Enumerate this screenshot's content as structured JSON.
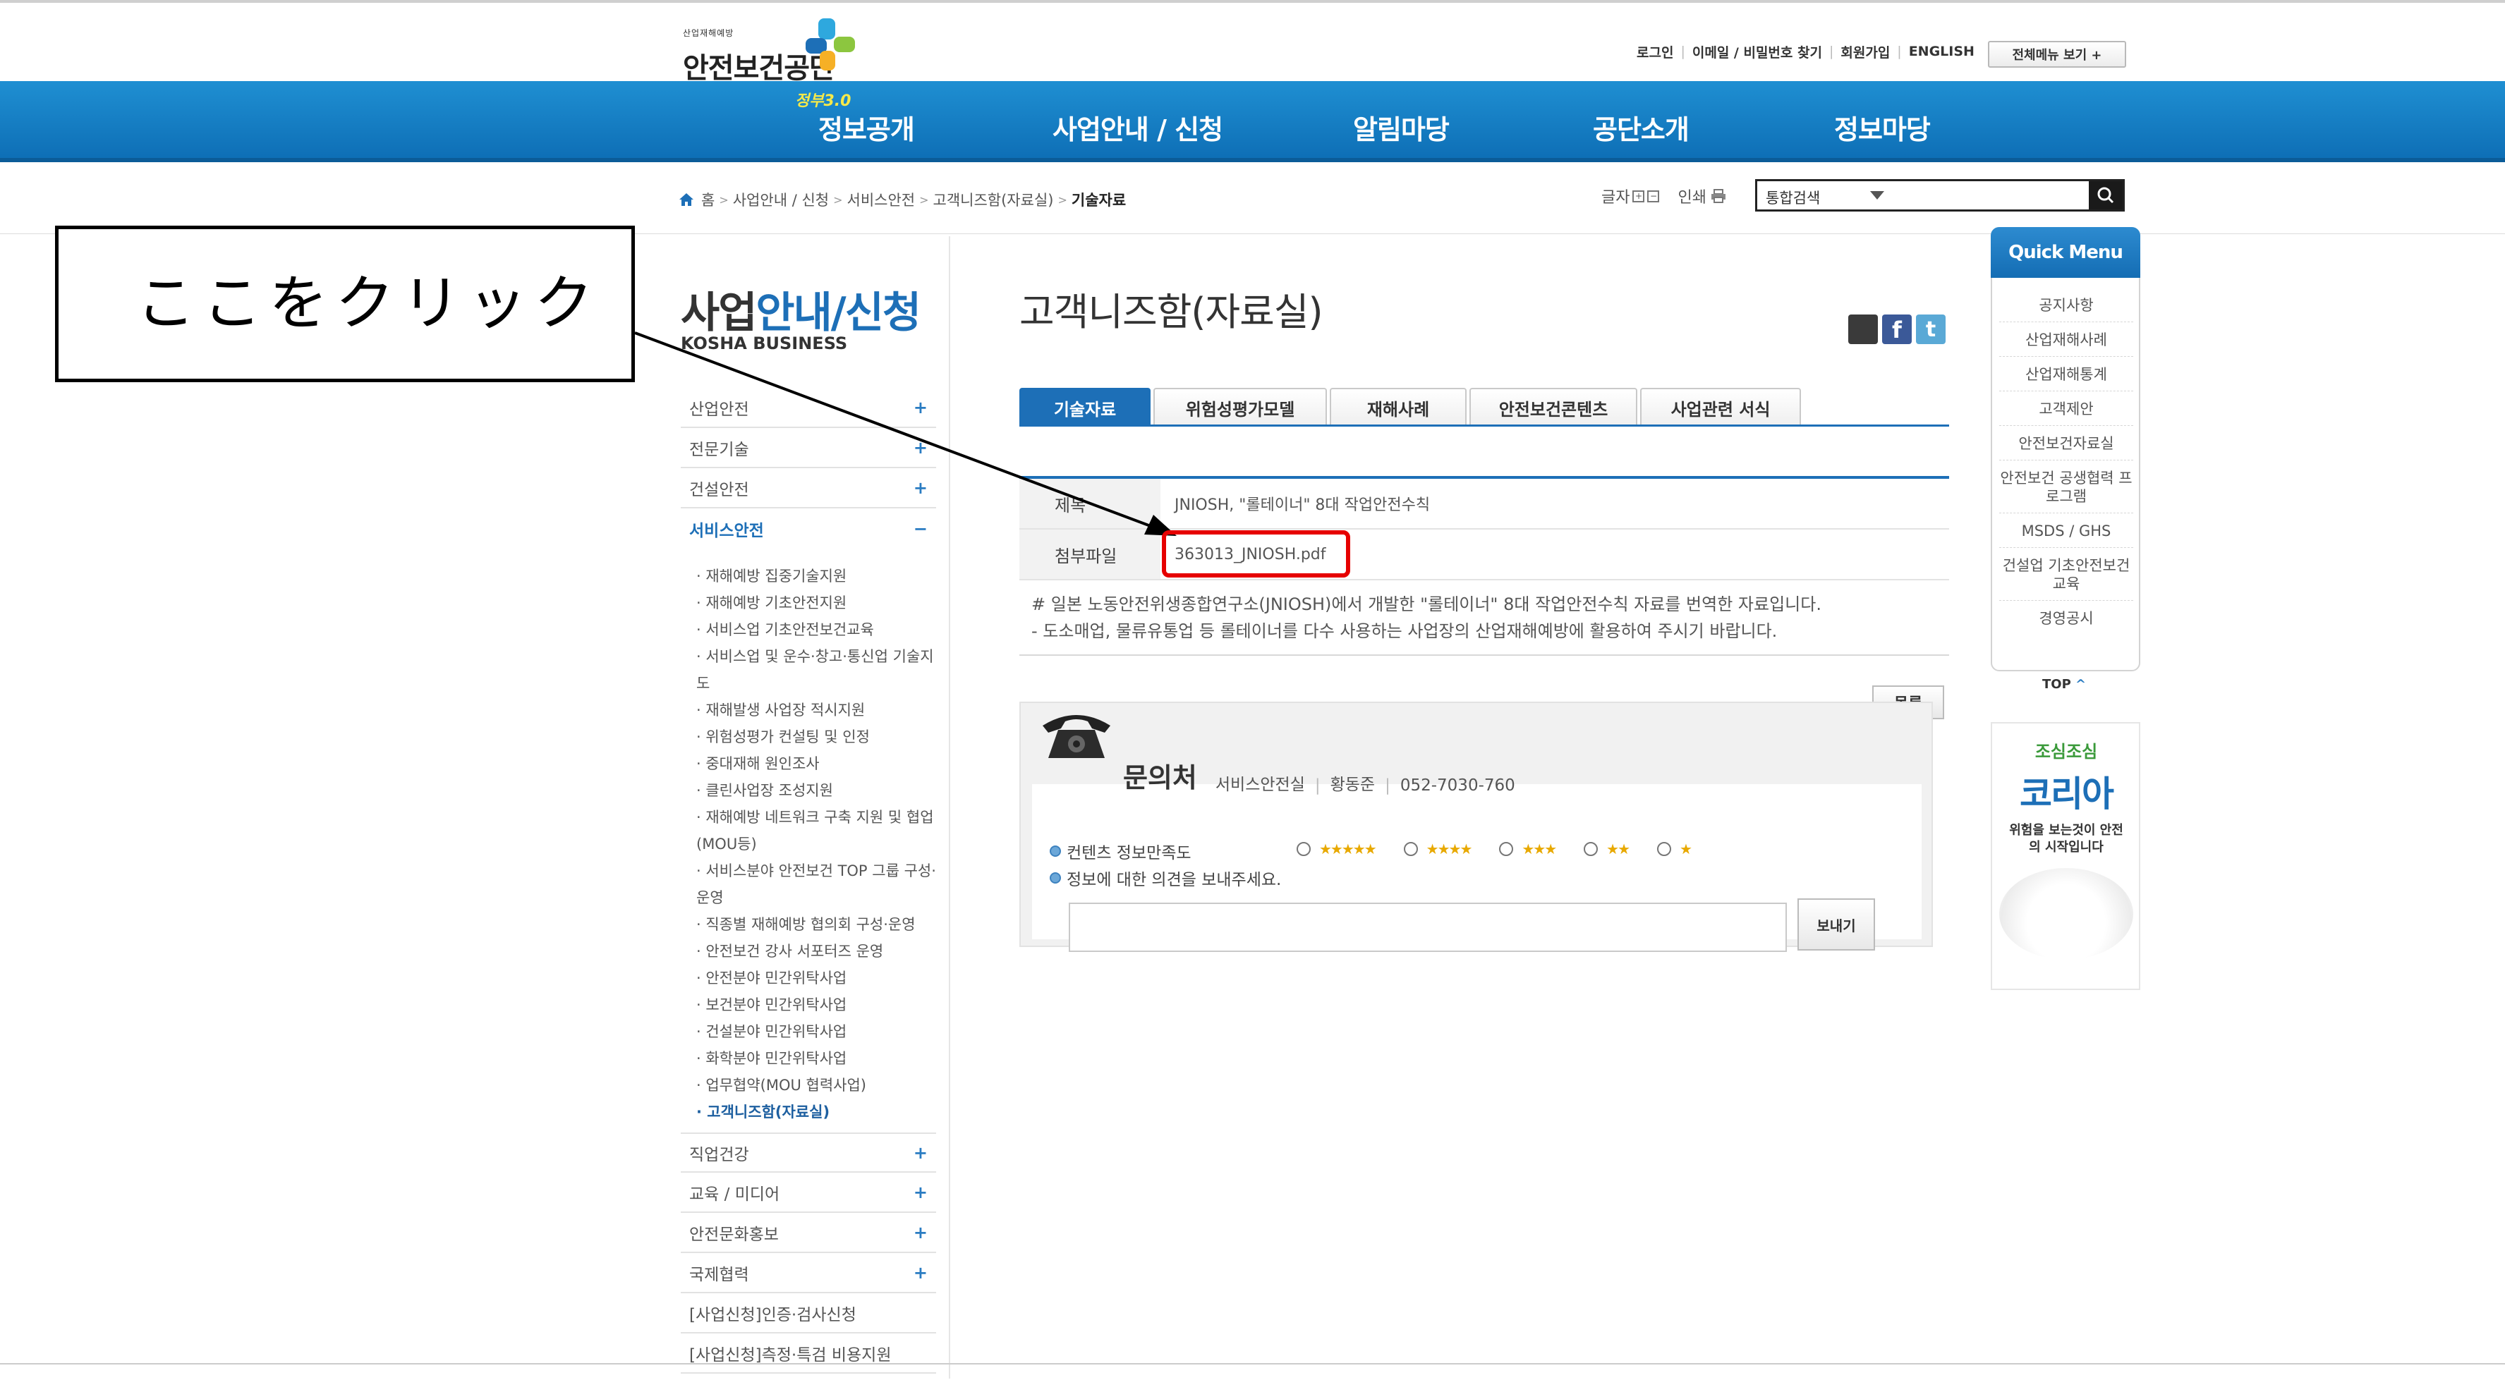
{
  "site": {
    "logo_small": "산업재해예방",
    "logo_name": "안전보건공단"
  },
  "util": {
    "login": "로그인",
    "find": "이메일 / 비밀번호 찾기",
    "join": "회원가입",
    "english": "ENGLISH",
    "all_menu": "전체메뉴 보기 +"
  },
  "gnb": {
    "badge": "정부3.0",
    "items": [
      "정보공개",
      "사업안내 / 신청",
      "알림마당",
      "공단소개",
      "정보마당"
    ]
  },
  "breadcrumb": {
    "items": [
      "홈",
      "사업안내 / 신청",
      "서비스안전",
      "고객니즈함(자료실)"
    ],
    "current": "기술자료"
  },
  "tools": {
    "font_label": "글자",
    "print_label": "인쇄",
    "search_scope": "통합검색"
  },
  "lnb": {
    "title_a": "사업",
    "title_b": "안내/신청",
    "subtitle": "KOSHA BUSINESS",
    "top": [
      {
        "label": "산업안전",
        "pm": "+"
      },
      {
        "label": "전문기술",
        "pm": "+"
      },
      {
        "label": "건설안전",
        "pm": "+"
      },
      {
        "label": "서비스안전",
        "pm": "−"
      }
    ],
    "subs": [
      "· 재해예방 집중기술지원",
      "· 재해예방 기초안전지원",
      "· 서비스업 기초안전보건교육",
      "· 서비스업 및 운수·창고·통신업 기술지도",
      "· 재해발생 사업장 적시지원",
      "· 위험성평가 컨설팅 및 인정",
      "· 중대재해 원인조사",
      "· 클린사업장 조성지원",
      "· 재해예방 네트워크 구축 지원 및 협업(MOU등)",
      "· 서비스분야 안전보건 TOP 그룹 구성·운영",
      "· 직종별 재해예방 협의회 구성·운영",
      "· 안전보건 강사 서포터즈 운영",
      "· 안전분야 민간위탁사업",
      "· 보건분야 민간위탁사업",
      "· 건설분야 민간위탁사업",
      "· 화학분야 민간위탁사업",
      "· 업무협약(MOU 협력사업)",
      "· 고객니즈함(자료실)"
    ],
    "bottom": [
      {
        "label": "직업건강",
        "pm": "+"
      },
      {
        "label": "교육 / 미디어",
        "pm": "+"
      },
      {
        "label": "안전문화홍보",
        "pm": "+"
      },
      {
        "label": "국제협력",
        "pm": "+"
      },
      {
        "label": "[사업신청]인증·검사신청",
        "pm": ""
      },
      {
        "label": "[사업신청]측정·특검 비용지원",
        "pm": ""
      }
    ]
  },
  "content": {
    "title": "고객니즈함(자료실)",
    "tabs": [
      "기술자료",
      "위험성평가모델",
      "재해사례",
      "안전보건콘텐츠",
      "사업관련 서식"
    ],
    "rows": [
      {
        "th": "제목",
        "td": "JNIOSH, \"롤테이너\" 8대 작업안전수칙"
      },
      {
        "th": "첨부파일",
        "td": "363013_JNIOSH.pdf"
      }
    ],
    "desc": [
      "# 일본 노동안전위생종합연구소(JNIOSH)에서 개발한 \"롤테이너\" 8대 작업안전수칙 자료를 번역한 자료입니다.",
      "- 도소매업, 물류유통업 등 롤테이너를 다수 사용하는 사업장의 산업재해예방에 활용하여 주시기 바랍니다."
    ],
    "list_button": "목록"
  },
  "feedback": {
    "contact_head": "문의처",
    "dept": "서비스안전실",
    "person": "황동준",
    "phone": "052-7030-760",
    "rate_label": "컨텐츠 정보만족도",
    "stars": [
      "★★★★★",
      "★★★★",
      "★★★",
      "★★",
      "★"
    ],
    "opinion_label": "정보에 대한 의견을 보내주세요.",
    "send": "보내기"
  },
  "quick": {
    "head": "Quick Menu",
    "items": [
      "공지사항",
      "산업재해사례",
      "산업재해통계",
      "고객제안",
      "안전보건자료실",
      "안전보건 공생협력 프로그램",
      "MSDS / GHS",
      "건설업 기초안전보건교육",
      "경영공시"
    ],
    "top": "TOP",
    "banner_a": "조심조심",
    "banner_b": "코리아",
    "banner_c": "위험을 보는것이 안전의 시작입니다"
  },
  "annotation": {
    "callout": "ここをクリック"
  },
  "colors": {
    "brand_blue": "#1d6fb7",
    "highlight_red": "#e60000"
  }
}
